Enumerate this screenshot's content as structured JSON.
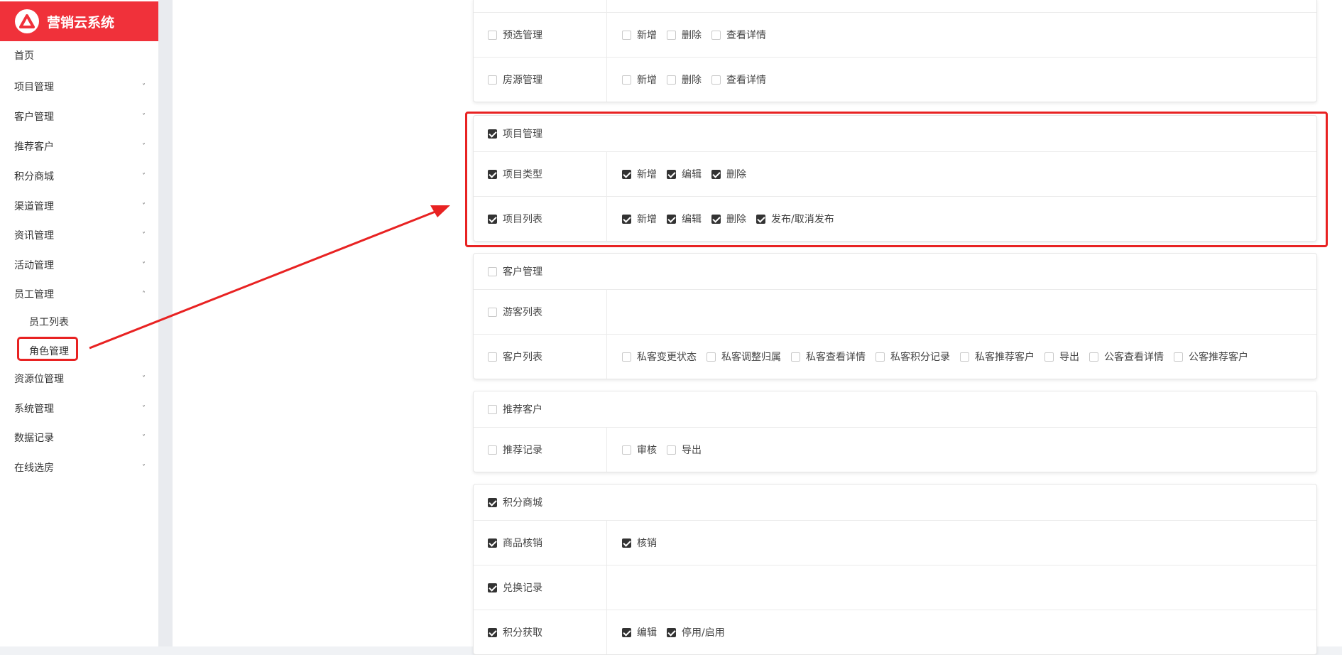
{
  "app": {
    "title": "营销云系统",
    "logo_icon": "triangle-logo-icon"
  },
  "colors": {
    "brand": "#f0313a",
    "highlight": "#e82222",
    "checked": "#333333"
  },
  "sidebar": {
    "items": [
      {
        "label": "首页"
      },
      {
        "label": "项目管理",
        "chevron": "˅"
      },
      {
        "label": "客户管理",
        "chevron": "˅"
      },
      {
        "label": "推荐客户",
        "chevron": "˅"
      },
      {
        "label": "积分商城",
        "chevron": "˅"
      },
      {
        "label": "渠道管理",
        "chevron": "˅"
      },
      {
        "label": "资讯管理",
        "chevron": "˅"
      },
      {
        "label": "活动管理",
        "chevron": "˅"
      },
      {
        "label": "员工管理",
        "chevron": "˄"
      },
      {
        "label": "资源位管理",
        "chevron": "˅"
      },
      {
        "label": "系统管理",
        "chevron": "˅"
      },
      {
        "label": "数据记录",
        "chevron": "˅"
      },
      {
        "label": "在线选房",
        "chevron": "˅"
      }
    ],
    "subitems": [
      {
        "label": "员工列表"
      },
      {
        "label": "角色管理"
      }
    ]
  },
  "permissions": {
    "card1": {
      "rows": [
        {
          "label": "预选管理",
          "checked": false,
          "actions": [
            {
              "label": "新增",
              "checked": false
            },
            {
              "label": "删除",
              "checked": false
            },
            {
              "label": "查看详情",
              "checked": false
            }
          ]
        },
        {
          "label": "房源管理",
          "checked": false,
          "actions": [
            {
              "label": "新增",
              "checked": false
            },
            {
              "label": "删除",
              "checked": false
            },
            {
              "label": "查看详情",
              "checked": false
            }
          ]
        }
      ]
    },
    "card2": {
      "header": {
        "label": "项目管理",
        "checked": true
      },
      "rows": [
        {
          "label": "项目类型",
          "checked": true,
          "actions": [
            {
              "label": "新增",
              "checked": true
            },
            {
              "label": "编辑",
              "checked": true
            },
            {
              "label": "删除",
              "checked": true
            }
          ]
        },
        {
          "label": "项目列表",
          "checked": true,
          "actions": [
            {
              "label": "新增",
              "checked": true
            },
            {
              "label": "编辑",
              "checked": true
            },
            {
              "label": "删除",
              "checked": true
            },
            {
              "label": "发布/取消发布",
              "checked": true
            }
          ]
        }
      ]
    },
    "card3": {
      "header": {
        "label": "客户管理",
        "checked": false
      },
      "rows": [
        {
          "label": "游客列表",
          "checked": false,
          "actions": []
        },
        {
          "label": "客户列表",
          "checked": false,
          "actions": [
            {
              "label": "私客变更状态",
              "checked": false
            },
            {
              "label": "私客调整归属",
              "checked": false
            },
            {
              "label": "私客查看详情",
              "checked": false
            },
            {
              "label": "私客积分记录",
              "checked": false
            },
            {
              "label": "私客推荐客户",
              "checked": false
            },
            {
              "label": "导出",
              "checked": false
            },
            {
              "label": "公客查看详情",
              "checked": false
            },
            {
              "label": "公客推荐客户",
              "checked": false
            }
          ]
        }
      ]
    },
    "card4": {
      "header": {
        "label": "推荐客户",
        "checked": false
      },
      "rows": [
        {
          "label": "推荐记录",
          "checked": false,
          "actions": [
            {
              "label": "审核",
              "checked": false
            },
            {
              "label": "导出",
              "checked": false
            }
          ]
        }
      ]
    },
    "card5": {
      "header": {
        "label": "积分商城",
        "checked": true
      },
      "rows": [
        {
          "label": "商品核销",
          "checked": true,
          "actions": [
            {
              "label": "核销",
              "checked": true
            }
          ]
        },
        {
          "label": "兑换记录",
          "checked": true,
          "actions": []
        },
        {
          "label": "积分获取",
          "checked": true,
          "actions": [
            {
              "label": "编辑",
              "checked": true
            },
            {
              "label": "停用/启用",
              "checked": true
            }
          ]
        }
      ]
    }
  }
}
